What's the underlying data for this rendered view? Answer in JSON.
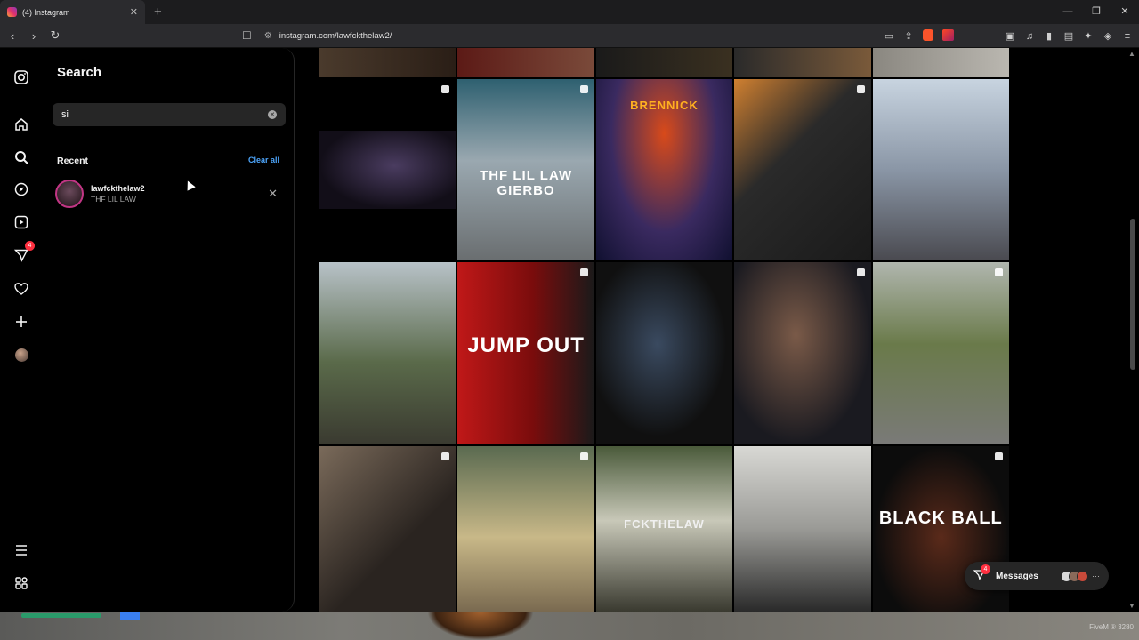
{
  "browser": {
    "tab_title": "(4) Instagram",
    "tab_close": "✕",
    "new_tab": "+",
    "url": "instagram.com/lawfckthelaw2/",
    "window_controls": [
      "—",
      "❐",
      "✕"
    ]
  },
  "rail": {
    "notifications_badge": "4"
  },
  "search": {
    "title": "Search",
    "query": "si",
    "clear_icon": "✕",
    "recent_label": "Recent",
    "clear_all": "Clear all",
    "recent": [
      {
        "username": "lawfckthelaw2",
        "name": "THF LIL LAW",
        "remove": "✕"
      }
    ]
  },
  "grid": {
    "captions": [
      "THF LIL LAW GIERBO",
      "BRENNICK",
      "JUMP OUT",
      "FCKTHELAW",
      "BLACK BALL"
    ]
  },
  "messages": {
    "label": "Messages",
    "badge": "4"
  },
  "game_overlay": {
    "watermark": "FiveM ® 3280"
  },
  "colors": {
    "accent_link": "#4ca3f8",
    "badge": "#ff3040",
    "panel_bg": "#000000",
    "input_bg": "#262626"
  }
}
